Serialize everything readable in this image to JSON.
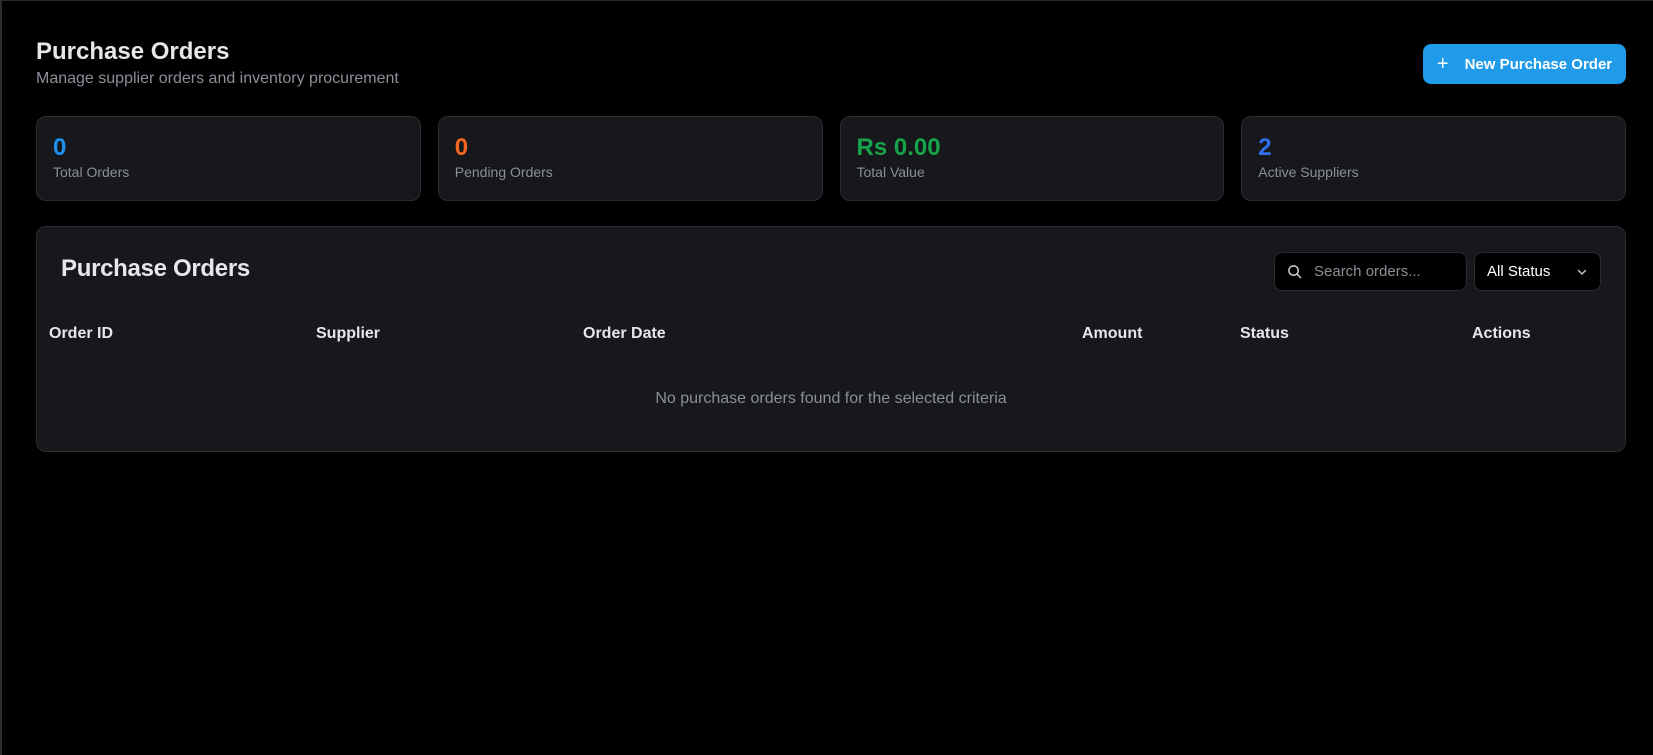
{
  "header": {
    "title": "Purchase Orders",
    "subtitle": "Manage supplier orders and inventory procurement",
    "new_button_label": "New Purchase Order",
    "new_button_icon": "plus-icon"
  },
  "stats": [
    {
      "value": "0",
      "label": "Total Orders",
      "color": "#1e90f0"
    },
    {
      "value": "0",
      "label": "Pending Orders",
      "color": "#f26522"
    },
    {
      "value": "Rs 0.00",
      "label": "Total Value",
      "color": "#16a34a"
    },
    {
      "value": "2",
      "label": "Active Suppliers",
      "color": "#2f6fec"
    }
  ],
  "table": {
    "title": "Purchase Orders",
    "search_placeholder": "Search orders...",
    "status_filter": "All Status",
    "columns": [
      "Order ID",
      "Supplier",
      "Order Date",
      "Amount",
      "Status",
      "Actions"
    ],
    "empty_message": "No purchase orders found for the selected criteria"
  }
}
